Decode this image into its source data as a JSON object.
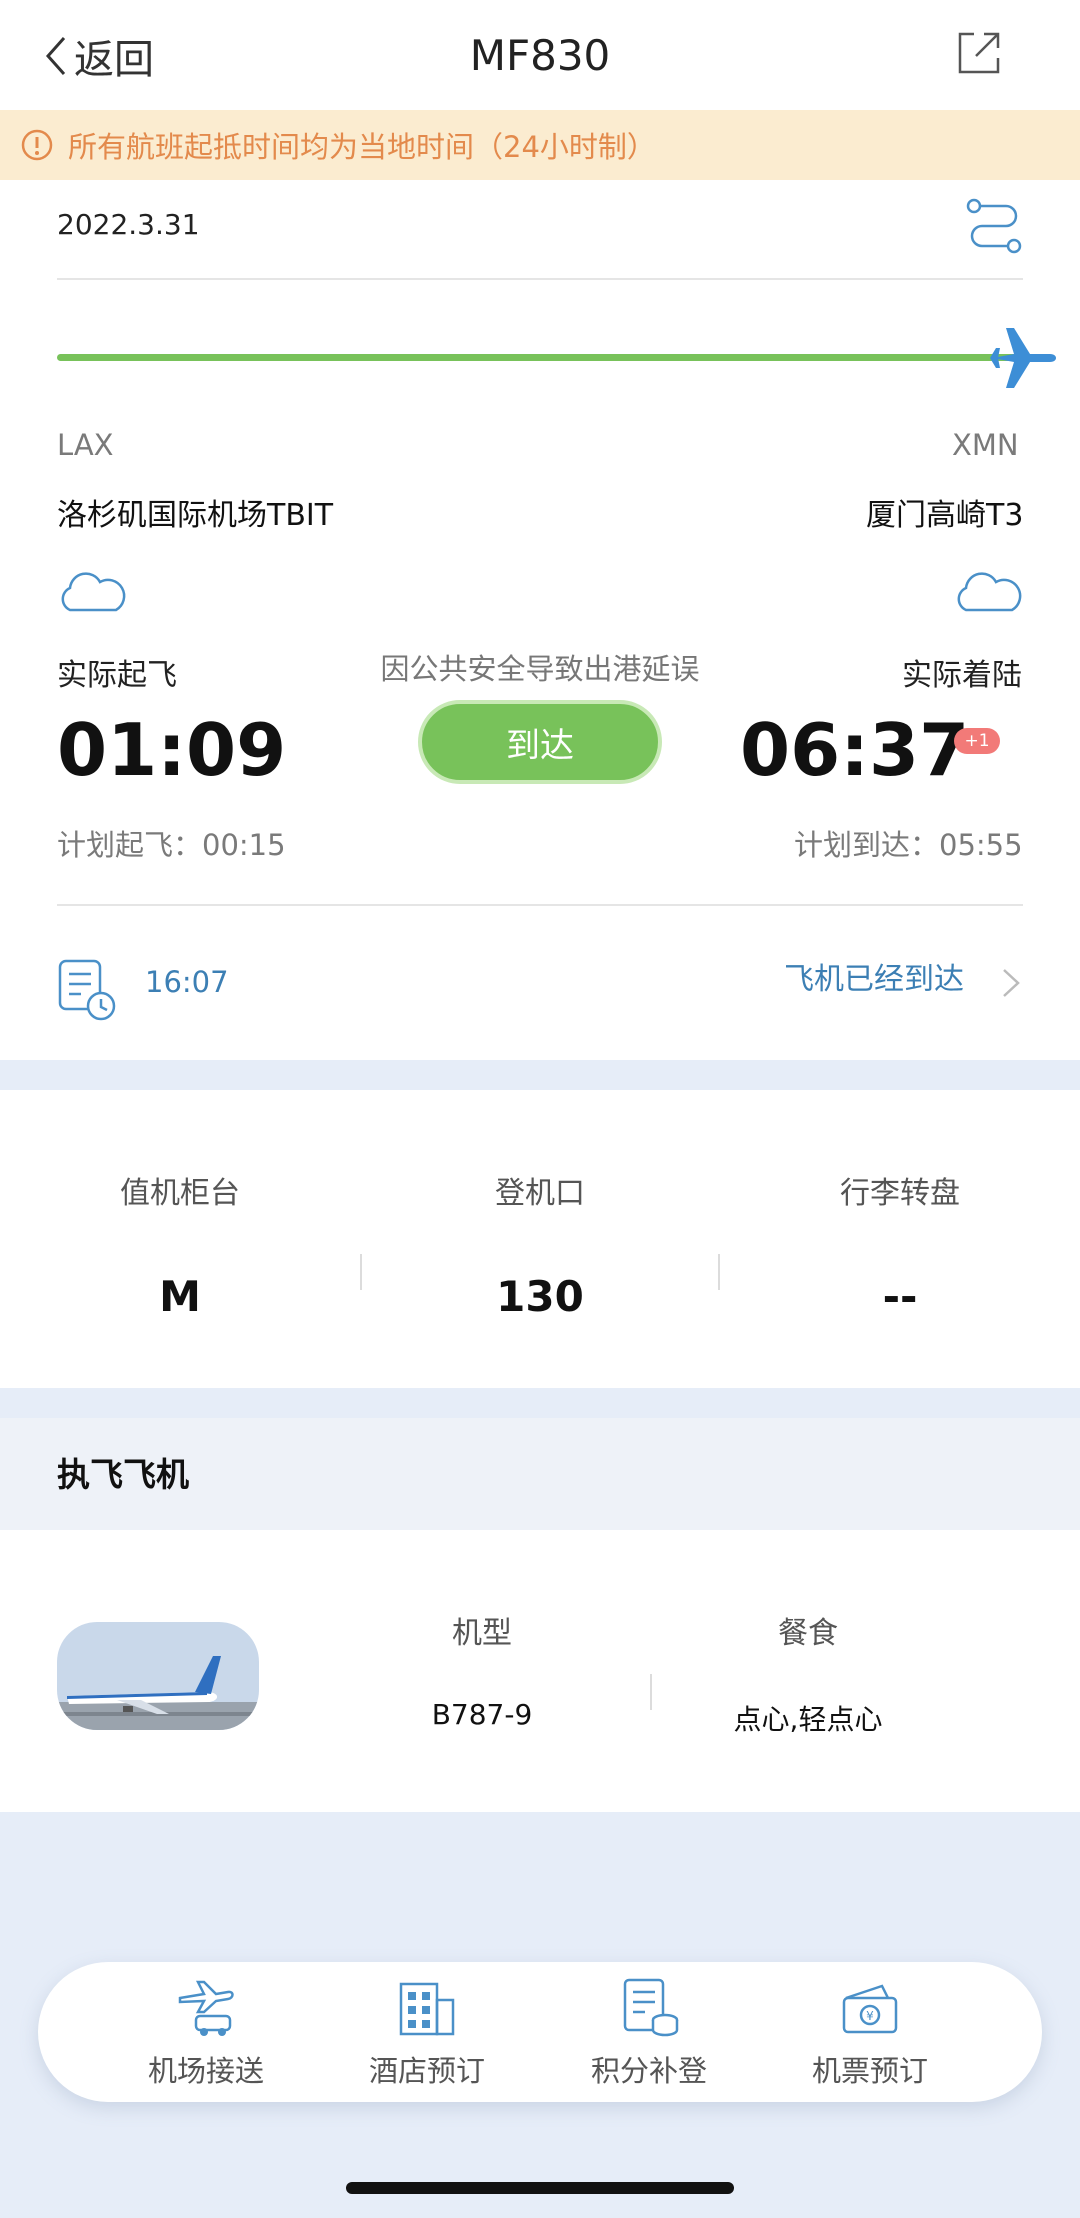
{
  "header": {
    "back_label": "返回",
    "title": "MF830"
  },
  "notice": {
    "text": "所有航班起抵时间均为当地时间（24小时制）",
    "color": "#e38a4c",
    "background": "#fbecd0"
  },
  "flight": {
    "date": "2022.3.31",
    "progress": 1.0,
    "origin": {
      "code": "LAX",
      "airport": "洛杉矶国际机场TBIT",
      "status_label": "实际起飞",
      "actual_time": "01:09",
      "planned": "计划起飞：00:15"
    },
    "destination": {
      "code": "XMN",
      "airport": "厦门高崎T3",
      "status_label": "实际着陆",
      "actual_time": "06:37",
      "day_offset": "+1",
      "planned": "计划到达：05:55"
    },
    "delay_reason": "因公共安全导致出港延误",
    "status_button": "到达",
    "update_time": "16:07",
    "status_message": "飞机已经到达"
  },
  "boarding": {
    "checkin_label": "值机柜台",
    "checkin_value": "M",
    "gate_label": "登机口",
    "gate_value": "130",
    "baggage_label": "行李转盘",
    "baggage_value": "--"
  },
  "aircraft": {
    "section_title": "执飞飞机",
    "type_label": "机型",
    "type_value": "B787-9",
    "meal_label": "餐食",
    "meal_value": "点心,轻点心"
  },
  "bottom_nav": [
    {
      "label": "机场接送",
      "icon": "airport-transfer-icon"
    },
    {
      "label": "酒店预订",
      "icon": "hotel-icon"
    },
    {
      "label": "积分补登",
      "icon": "points-icon"
    },
    {
      "label": "机票预订",
      "icon": "ticket-icon"
    }
  ],
  "colors": {
    "accent_green": "#78c25a",
    "link_blue": "#3c7fb4",
    "badge_red": "#f27a78",
    "page_bg": "#e6edf8"
  }
}
